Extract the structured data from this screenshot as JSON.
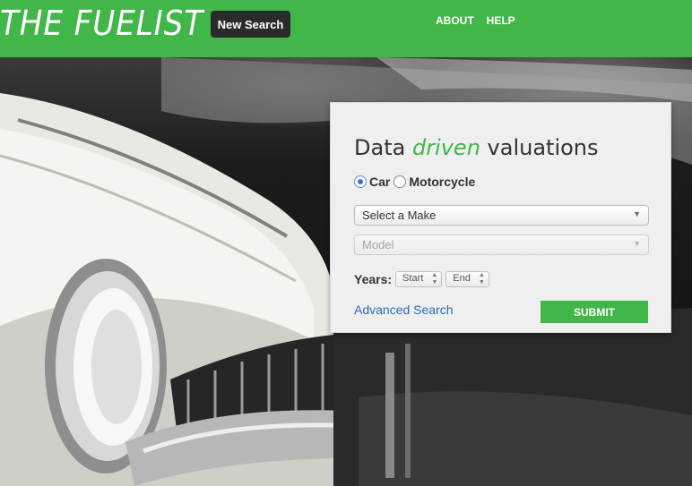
{
  "header": {
    "logo": "THE FUELIST",
    "new_search_label": "New Search",
    "nav": [
      "ABOUT",
      "HELP"
    ]
  },
  "search_card": {
    "title_prefix": "Data",
    "title_accent": "driven",
    "title_suffix": "valuations",
    "vehicle_options": [
      {
        "label": "Car",
        "selected": true
      },
      {
        "label": "Motorcycle",
        "selected": false
      }
    ],
    "make_select": {
      "value": "Select a Make"
    },
    "model_select": {
      "value": "Model",
      "disabled": true
    },
    "years": {
      "label": "Years:",
      "start": "Start",
      "end": "End"
    },
    "advanced_link": "Advanced Search",
    "submit_label": "SUBMIT"
  },
  "colors": {
    "brand_green": "#41b649",
    "link_blue": "#2d6db5",
    "button_dark": "#2b2b2b"
  }
}
